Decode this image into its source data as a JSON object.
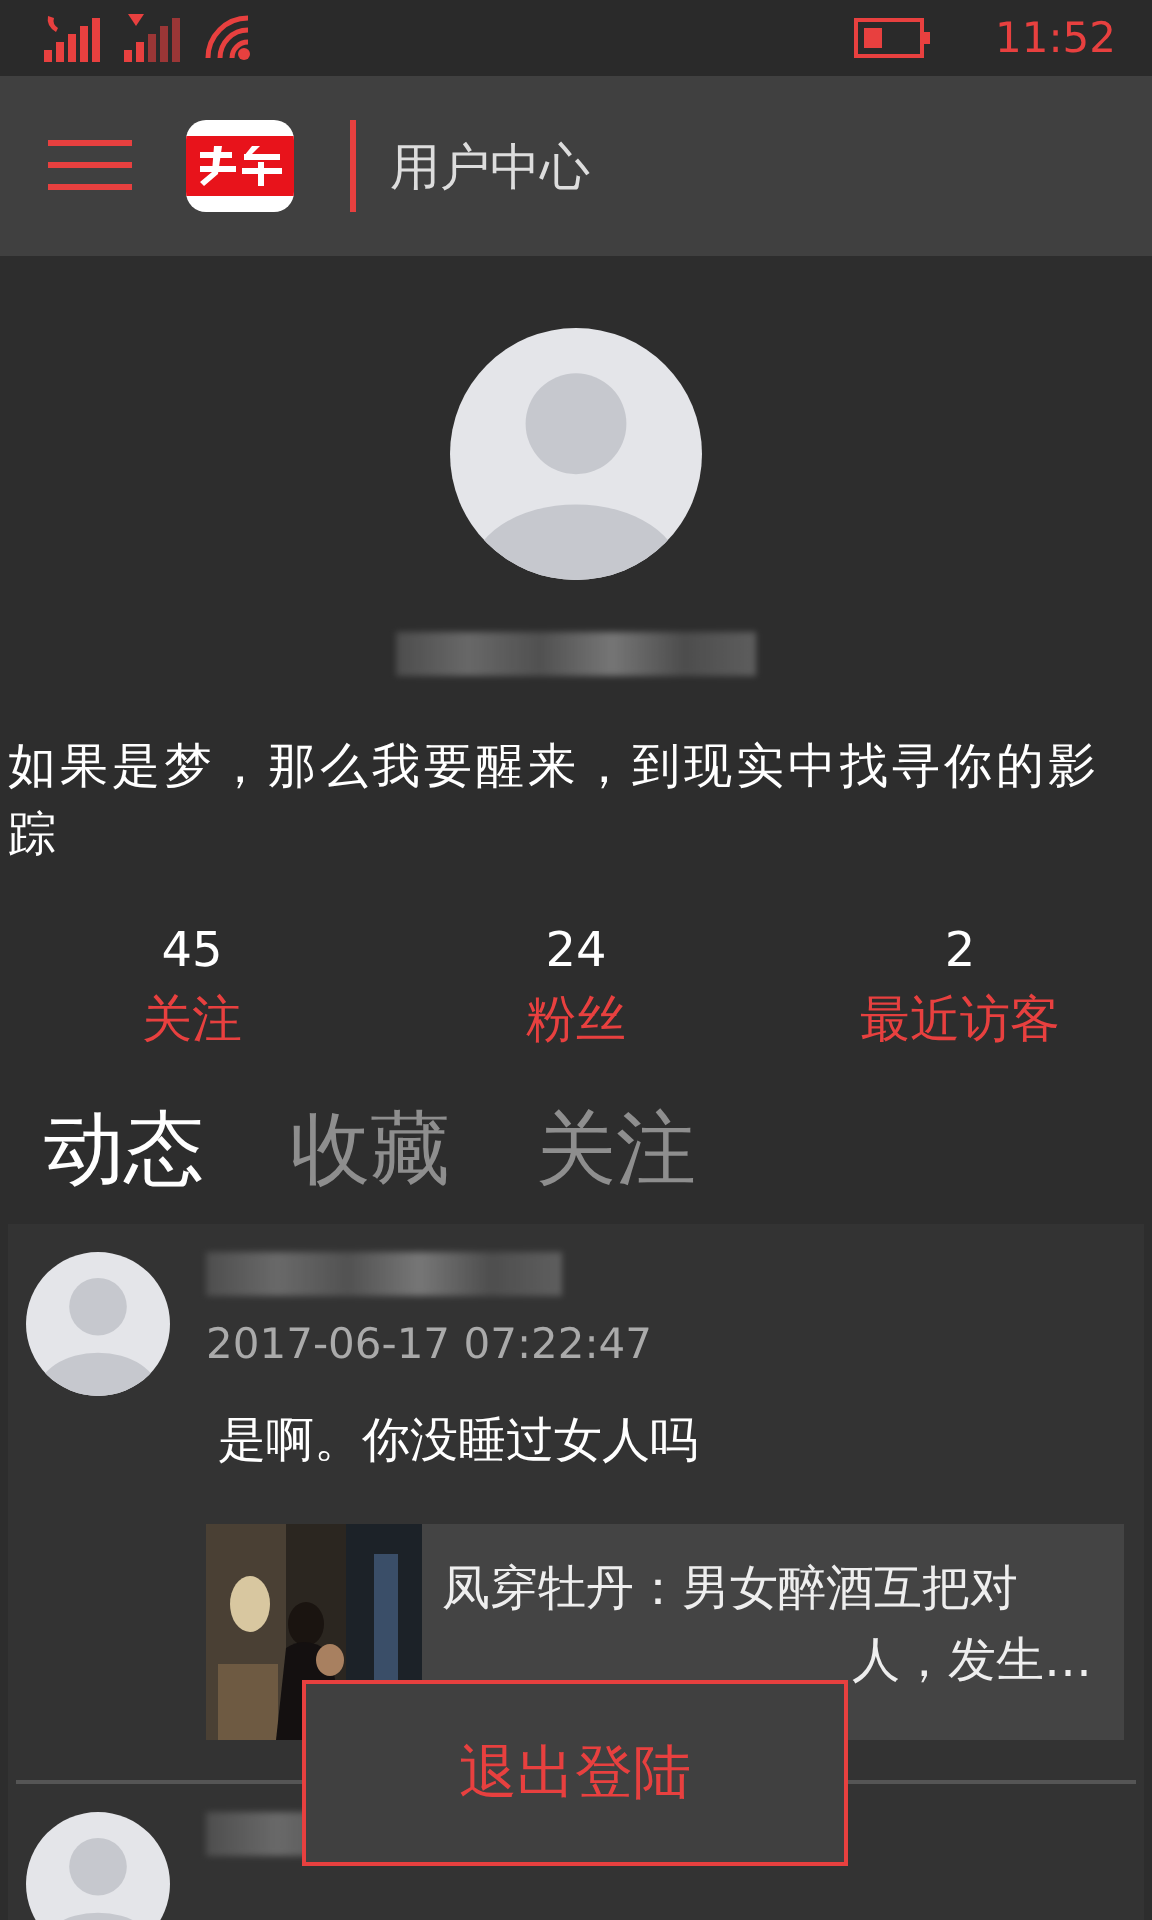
{
  "status_bar": {
    "time": "11:52"
  },
  "header": {
    "title": "用户中心"
  },
  "profile": {
    "bio": "如果是梦，那么我要醒来，到现实中找寻你的影踪"
  },
  "stats": [
    {
      "count": "45",
      "label": "关注"
    },
    {
      "count": "24",
      "label": "粉丝"
    },
    {
      "count": "2",
      "label": "最近访客"
    }
  ],
  "tabs": [
    {
      "label": "动态",
      "selected": true
    },
    {
      "label": "收藏",
      "selected": false
    },
    {
      "label": "关注",
      "selected": false
    }
  ],
  "posts": [
    {
      "kind": "full",
      "date": "2017-06-17 07:22:47",
      "content": "是啊。你没睡过女人吗",
      "link": {
        "kind": "picture",
        "title_lines": [
          "凤穿牡丹：男女醉酒互把对",
          "人，发生…"
        ]
      }
    },
    {
      "kind": "cut"
    }
  ],
  "logout_menu": {
    "item": "退出登陆"
  }
}
